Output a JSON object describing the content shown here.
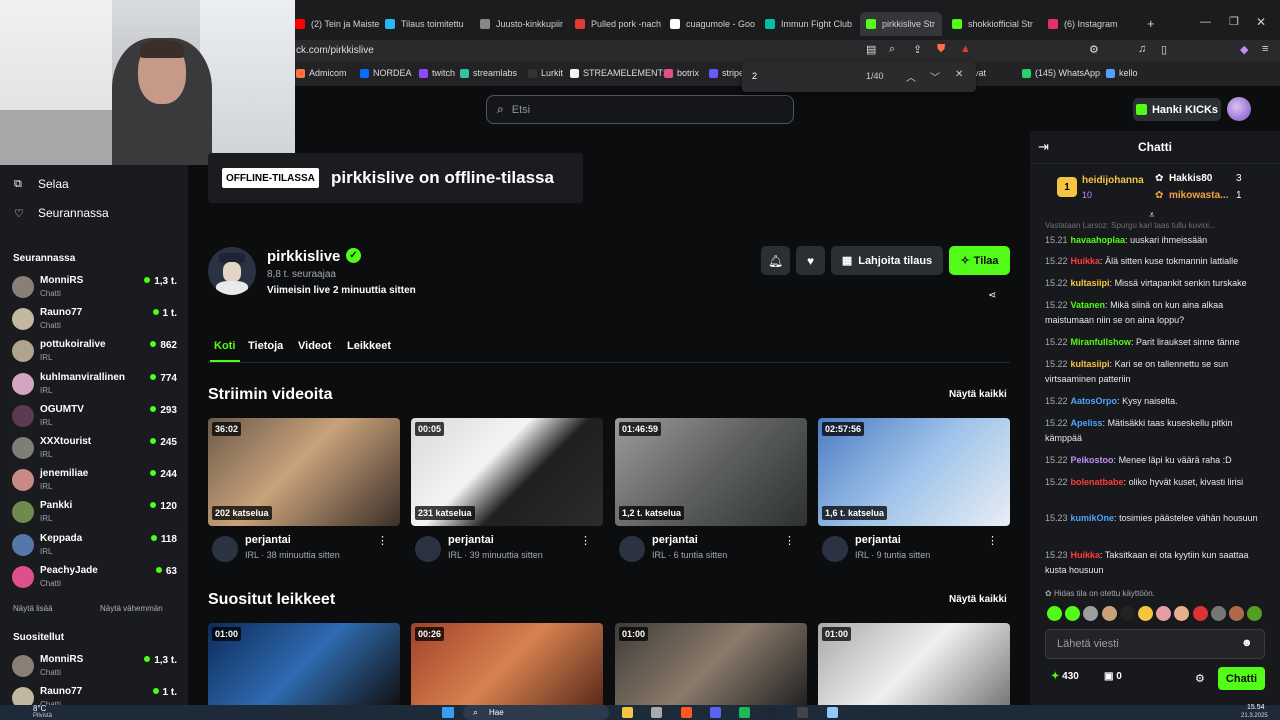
{
  "browser": {
    "tabs": [
      {
        "label": "(2) Tein ja Maiste",
        "color": "#ff0000"
      },
      {
        "label": "Tilaus toimitettu",
        "color": "#29b6f6"
      },
      {
        "label": "Juusto-kinkkupiir",
        "color": "#888888"
      },
      {
        "label": "Pulled pork -nach",
        "color": "#e53935"
      },
      {
        "label": "cuagumole - Goo",
        "color": "#ffffff"
      },
      {
        "label": "Immun Fight Club",
        "color": "#00bfa5"
      },
      {
        "label": "pirkkislive Str",
        "color": "#53fc18"
      },
      {
        "label": "shokkiofficial Str",
        "color": "#53fc18"
      },
      {
        "label": "(6) Instagram",
        "color": "#e1306c"
      }
    ],
    "address": "ck.com/pirkkislive",
    "bookmarks": [
      "Admicom",
      "NORDEA",
      "twitch",
      "streamlabs",
      "Lurkit",
      "STREAMELEMENTS",
      "botrix",
      "stripe",
      "hiivat",
      "(145) WhatsApp",
      "kello"
    ],
    "find": {
      "query": "2",
      "count": "1/40"
    }
  },
  "header": {
    "search_placeholder": "Etsi",
    "kicks_label": "Hanki KICKs"
  },
  "sidebar": {
    "nav": [
      {
        "label": "Selaa",
        "icon": "compass-icon"
      },
      {
        "label": "Seurannassa",
        "icon": "heart-icon"
      }
    ],
    "following_title": "Seurannassa",
    "following": [
      {
        "name": "MonniRS",
        "cat": "Chatti",
        "viewers": "1,3 t.",
        "color": "#8a7f76"
      },
      {
        "name": "Rauno77",
        "cat": "Chatti",
        "viewers": "1 t.",
        "color": "#c2b79f"
      },
      {
        "name": "pottukoiralive",
        "cat": "IRL",
        "viewers": "862",
        "color": "#b0a38f"
      },
      {
        "name": "kuhlmanvirallinen",
        "cat": "IRL",
        "viewers": "774",
        "color": "#d4a4c0"
      },
      {
        "name": "OGUMTV",
        "cat": "IRL",
        "viewers": "293",
        "color": "#5d3a50"
      },
      {
        "name": "XXXtourist",
        "cat": "IRL",
        "viewers": "245",
        "color": "#7d7f73"
      },
      {
        "name": "jenemiliae",
        "cat": "IRL",
        "viewers": "244",
        "color": "#c88a84"
      },
      {
        "name": "Pankki",
        "cat": "IRL",
        "viewers": "120",
        "color": "#6f8a4a"
      },
      {
        "name": "Keppada",
        "cat": "IRL",
        "viewers": "118",
        "color": "#5577aa"
      },
      {
        "name": "PeachyJade",
        "cat": "Chatti",
        "viewers": "63",
        "color": "#e04f8a"
      }
    ],
    "show_more": "Näytä lisää",
    "show_less": "Näytä vähemmän",
    "recommended_title": "Suositellut",
    "recommended": [
      {
        "name": "MonniRS",
        "cat": "Chatti",
        "viewers": "1,3 t.",
        "color": "#8a7f76"
      },
      {
        "name": "Rauno77",
        "cat": "Chatti",
        "viewers": "1 t.",
        "color": "#c2b79f"
      }
    ]
  },
  "channel": {
    "offline_badge": "OFFLINE-TILASSA",
    "offline_title": "pirkkislive on offline-tilassa",
    "name": "pirkkislive",
    "followers": "8,8 t. seuraajaa",
    "last_live": "Viimeisin live 2 minuuttia sitten",
    "gift_label": "Lahjoita tilaus",
    "subscribe_label": "Tilaa",
    "tabs": [
      "Koti",
      "Tietoja",
      "Videot",
      "Leikkeet"
    ]
  },
  "videos": {
    "title": "Striimin videoita",
    "see_all": "Näytä kaikki",
    "items": [
      {
        "duration": "36:02",
        "views": "202 katselua",
        "title": "perjantai",
        "sub": "IRL · 38 minuuttia sitten",
        "bg": "linear-gradient(135deg,#6b5a4a,#c9a27a 45%,#3a2f28)"
      },
      {
        "duration": "00:05",
        "views": "231 katselua",
        "title": "perjantai",
        "sub": "IRL · 39 minuuttia sitten",
        "bg": "linear-gradient(135deg,#d9d9d9,#f4f4f4 40%,#1f1f1f 60%,#2c2c2c)"
      },
      {
        "duration": "01:46:59",
        "views": "1,2 t. katselua",
        "title": "perjantai",
        "sub": "IRL · 6 tuntia sitten",
        "bg": "linear-gradient(135deg,#9a9c9c,#5d605f 50%,#2e3031)"
      },
      {
        "duration": "02:57:56",
        "views": "1,6 t. katselua",
        "title": "perjantai",
        "sub": "IRL · 9 tuntia sitten",
        "bg": "linear-gradient(135deg,#4b7bc2,#9fc3ea 50%,#e9eef4)"
      }
    ]
  },
  "clips": {
    "title": "Suositut leikkeet",
    "see_all": "Näytä kaikki",
    "items": [
      {
        "duration": "01:00",
        "bg": "linear-gradient(135deg,#0d2a5a,#2f6bb0 50%,#111)"
      },
      {
        "duration": "00:26",
        "bg": "linear-gradient(135deg,#a2402a,#d6824f 50%,#5b2a1c)"
      },
      {
        "duration": "01:00",
        "bg": "linear-gradient(135deg,#3e3b37,#8a7a6a 50%,#222)"
      },
      {
        "duration": "01:00",
        "bg": "linear-gradient(135deg,#a8a8a8,#f0f0f0 50%,#777)"
      }
    ]
  },
  "chat": {
    "title": "Chatti",
    "top_gifter": {
      "name": "heidijohanna",
      "count": "10"
    },
    "leaders": [
      {
        "name": "Hakkis80",
        "count": "3"
      },
      {
        "name": "mikowasta...",
        "count": "1"
      }
    ],
    "pinned_text": "Vastataan Larsoz: Spurgu kari taas tullu kuvioi...",
    "messages": [
      {
        "time": "15.21",
        "user": "havaahoplaa",
        "color": "#53fc18",
        "text": "uuskari ihmeissään"
      },
      {
        "time": "15.22",
        "user": "Huikka",
        "color": "#ff3b3b",
        "text": "Älä sitten kuse tokmannin lattialle"
      },
      {
        "time": "15.22",
        "user": "kultasiipi",
        "color": "#f5c542",
        "text": "Missä virtapankit senkin turskake"
      },
      {
        "time": "15.22",
        "user": "Vatanen",
        "color": "#53fc18",
        "text": "Mikä siinä on kun aina alkaa maistumaan niin se on aina loppu?"
      },
      {
        "time": "15.22",
        "user": "Miranfullshow",
        "color": "#53fc18",
        "text": "Parit liraukset sinne tänne"
      },
      {
        "time": "15.22",
        "user": "kultasiipi",
        "color": "#f5c542",
        "text": "Kari se on tallennettu se sun virtsaaminen patteriin"
      },
      {
        "time": "15.22",
        "user": "AatosOrpo",
        "color": "#4fa3ff",
        "text": "Kysy naiselta."
      },
      {
        "time": "15.22",
        "user": "Apeliss",
        "color": "#4fa3ff",
        "text": "Mätisäkki taas kuseskellu pitkin kämppää"
      },
      {
        "time": "15.22",
        "user": "Peikostoo",
        "color": "#c48cff",
        "text": "Menee läpi ku väärä raha :D"
      },
      {
        "time": "15.22",
        "user": "bolenatbabe",
        "color": "#ff3b3b",
        "text": "oliko hyvät kuset, kivasti lirisi"
      },
      {
        "time": "15.23",
        "user": "kumikOne",
        "color": "#4fa3ff",
        "text": "tosimies päästelee vähän housuun"
      },
      {
        "time": "15.23",
        "user": "Huikka",
        "color": "#ff3b3b",
        "text": "Taksitkaan ei ota kyytiin kun saattaa kusta housuun"
      }
    ],
    "slow_mode": "Hidas tila on otettu käyttöön.",
    "input_placeholder": "Lähetä viesti",
    "points": "430",
    "gifts": "0",
    "send_label": "Chatti"
  },
  "taskbar": {
    "weather": "8°C",
    "weather_sub": "Pilvistä",
    "search": "Hae",
    "time": "15.54",
    "date": "21.3.2025"
  }
}
